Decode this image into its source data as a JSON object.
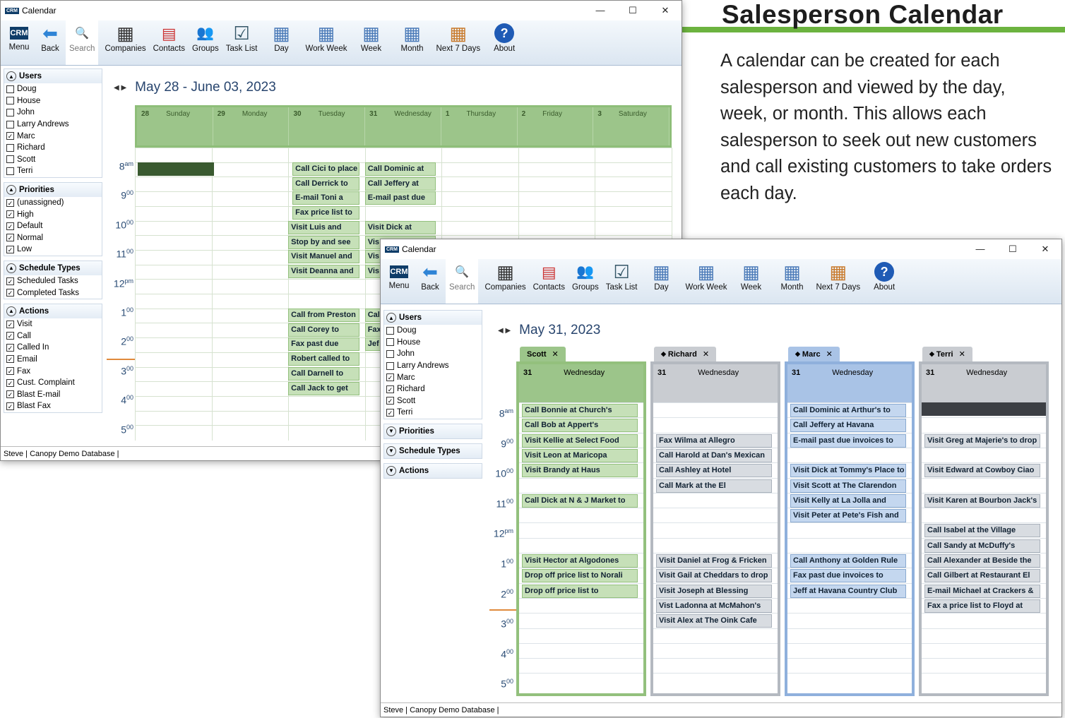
{
  "heading": "Salesperson Calendar",
  "paragraph": "A calendar can be created for each salesperson and viewed by the day, week, or month. This allows each salesperson to seek out new customers and call existing customers to take orders each day.",
  "colors": {
    "green": "#6cb33f",
    "scott": "#9cc58a",
    "richard": "#c9ccd1",
    "marc": "#a9c3e6",
    "terri": "#c9ccd1"
  },
  "window": {
    "title": "Calendar",
    "logo": "CRM",
    "min": "—",
    "max": "☐",
    "close": "✕"
  },
  "toolbar": [
    {
      "label": "Menu",
      "icon": "crm-logo-icon"
    },
    {
      "label": "Back",
      "icon": "back-arrow-icon"
    },
    {
      "label": "Search",
      "icon": "search-icon"
    },
    {
      "label": "Companies",
      "icon": "building-icon"
    },
    {
      "label": "Contacts",
      "icon": "contact-card-icon"
    },
    {
      "label": "Groups",
      "icon": "group-icon"
    },
    {
      "label": "Task List",
      "icon": "checklist-icon"
    },
    {
      "label": "Day",
      "icon": "calendar-day-icon"
    },
    {
      "label": "Work Week",
      "icon": "calendar-workweek-icon"
    },
    {
      "label": "Week",
      "icon": "calendar-week-icon"
    },
    {
      "label": "Month",
      "icon": "calendar-month-icon"
    },
    {
      "label": "Next 7 Days",
      "icon": "calendar-next7-icon"
    },
    {
      "label": "About",
      "icon": "help-icon"
    }
  ],
  "sidebar": {
    "users_title": "Users",
    "priorities_title": "Priorities",
    "schedule_types_title": "Schedule Types",
    "actions_title": "Actions",
    "users1": [
      {
        "n": "Doug",
        "c": false
      },
      {
        "n": "House",
        "c": false
      },
      {
        "n": "John",
        "c": false
      },
      {
        "n": "Larry Andrews",
        "c": false
      },
      {
        "n": "Marc",
        "c": true
      },
      {
        "n": "Richard",
        "c": false
      },
      {
        "n": "Scott",
        "c": false
      },
      {
        "n": "Terri",
        "c": false
      }
    ],
    "users2": [
      {
        "n": "Doug",
        "c": false
      },
      {
        "n": "House",
        "c": false
      },
      {
        "n": "John",
        "c": false
      },
      {
        "n": "Larry Andrews",
        "c": false
      },
      {
        "n": "Marc",
        "c": true
      },
      {
        "n": "Richard",
        "c": true
      },
      {
        "n": "Scott",
        "c": true
      },
      {
        "n": "Terri",
        "c": true
      }
    ],
    "priorities": [
      "(unassigned)",
      "High",
      "Default",
      "Normal",
      "Low"
    ],
    "schedule_types": [
      "Scheduled Tasks",
      "Completed Tasks"
    ],
    "actions": [
      "Visit",
      "Call",
      "Called In",
      "Email",
      "Fax",
      "Cust. Complaint",
      "Blast E-mail",
      "Blast Fax"
    ]
  },
  "status": "Steve | Canopy Demo Database |",
  "week": {
    "range": "May 28 - June 03, 2023",
    "days": [
      {
        "d": "28",
        "n": "Sunday"
      },
      {
        "d": "29",
        "n": "Monday"
      },
      {
        "d": "30",
        "n": "Tuesday"
      },
      {
        "d": "31",
        "n": "Wednesday"
      },
      {
        "d": "1",
        "n": "Thursday"
      },
      {
        "d": "2",
        "n": "Friday"
      },
      {
        "d": "3",
        "n": "Saturday"
      }
    ],
    "times": [
      [
        "8",
        "am"
      ],
      [
        "9",
        "00"
      ],
      [
        "10",
        "00"
      ],
      [
        "11",
        "00"
      ],
      [
        "12",
        "pm"
      ],
      [
        "1",
        "00"
      ],
      [
        "2",
        "00"
      ],
      [
        "3",
        "00"
      ],
      [
        "4",
        "00"
      ],
      [
        "5",
        "00"
      ]
    ],
    "events": [
      {
        "day": 2,
        "slot": 0,
        "t": "Call Cici to place"
      },
      {
        "day": 2,
        "slot": 1,
        "t": "Call Derrick to"
      },
      {
        "day": 2,
        "slot": 2,
        "t": "E-mail Toni a"
      },
      {
        "day": 2,
        "slot": 3,
        "t": "Fax price list to"
      },
      {
        "day": 2,
        "slot": 4,
        "t": "Visit Luis and"
      },
      {
        "day": 2,
        "slot": 5,
        "t": "Stop by and see"
      },
      {
        "day": 2,
        "slot": 6,
        "t": "Visit Manuel and"
      },
      {
        "day": 2,
        "slot": 7,
        "t": "Visit Deanna and"
      },
      {
        "day": 2,
        "slot": 10,
        "t": "Call from Preston"
      },
      {
        "day": 2,
        "slot": 11,
        "t": "Call Corey to"
      },
      {
        "day": 2,
        "slot": 12,
        "t": "Fax past due"
      },
      {
        "day": 2,
        "slot": 13,
        "t": "Robert called to"
      },
      {
        "day": 2,
        "slot": 14,
        "t": "Call Darnell to"
      },
      {
        "day": 2,
        "slot": 15,
        "t": "Call Jack to get"
      },
      {
        "day": 3,
        "slot": 0,
        "t": "Call Dominic at"
      },
      {
        "day": 3,
        "slot": 1,
        "t": "Call Jeffery at"
      },
      {
        "day": 3,
        "slot": 2,
        "t": "E-mail past due"
      },
      {
        "day": 3,
        "slot": 4,
        "t": "Visit Dick at"
      },
      {
        "day": 3,
        "slot": 5,
        "t": "Vis"
      },
      {
        "day": 3,
        "slot": 6,
        "t": "Vis"
      },
      {
        "day": 3,
        "slot": 7,
        "t": "Vis"
      },
      {
        "day": 3,
        "slot": 10,
        "t": "Cal"
      },
      {
        "day": 3,
        "slot": 11,
        "t": "Fax"
      },
      {
        "day": 3,
        "slot": 12,
        "t": "Jef"
      }
    ]
  },
  "day": {
    "date": "May 31, 2023",
    "day_num": "31",
    "day_name": "Wednesday",
    "times": [
      [
        "8",
        "am"
      ],
      [
        "9",
        "00"
      ],
      [
        "10",
        "00"
      ],
      [
        "11",
        "00"
      ],
      [
        "12",
        "pm"
      ],
      [
        "1",
        "00"
      ],
      [
        "2",
        "00"
      ],
      [
        "3",
        "00"
      ],
      [
        "4",
        "00"
      ],
      [
        "5",
        "00"
      ]
    ],
    "people": [
      {
        "name": "Scott",
        "close": "✕",
        "arrow": "",
        "events": [
          {
            "slot": 0,
            "t": "Call Bonnie at Church's"
          },
          {
            "slot": 1,
            "t": "Call Bob at Appert's"
          },
          {
            "slot": 2,
            "t": "Visit Kellie at Select Food"
          },
          {
            "slot": 3,
            "t": "Visit Leon at Maricopa"
          },
          {
            "slot": 4,
            "t": "Visit Brandy at Haus"
          },
          {
            "slot": 6,
            "t": "Call Dick at N & J Market to"
          },
          {
            "slot": 10,
            "t": "Visit Hector at Algodones"
          },
          {
            "slot": 11,
            "t": "Drop off price list to Norali"
          },
          {
            "slot": 12,
            "t": "Drop off price list to"
          }
        ]
      },
      {
        "name": "Richard",
        "close": "✕",
        "arrow": "◆",
        "events": [
          {
            "slot": 2,
            "t": "Fax Wilma at Allegro"
          },
          {
            "slot": 3,
            "t": "Call Harold at Dan's Mexican"
          },
          {
            "slot": 4,
            "t": "Call Ashley at Hotel"
          },
          {
            "slot": 5,
            "t": "Call Mark at the El"
          },
          {
            "slot": 10,
            "t": "Visit Daniel at Frog & Fricken"
          },
          {
            "slot": 11,
            "t": "Visit Gail at Cheddars to drop"
          },
          {
            "slot": 12,
            "t": "Visit Joseph at Blessing"
          },
          {
            "slot": 13,
            "t": "Vist Ladonna at McMahon's"
          },
          {
            "slot": 14,
            "t": "Visit Alex at The Oink Cafe"
          }
        ]
      },
      {
        "name": "Marc",
        "close": "✕",
        "arrow": "◆",
        "events": [
          {
            "slot": 0,
            "t": "Call Dominic at Arthur's to"
          },
          {
            "slot": 1,
            "t": "Call Jeffery at Havana"
          },
          {
            "slot": 2,
            "t": "E-mail past due invoices to"
          },
          {
            "slot": 4,
            "t": "Visit Dick at Tommy's Place to"
          },
          {
            "slot": 5,
            "t": "Visit Scott at The Clarendon"
          },
          {
            "slot": 6,
            "t": "Visit Kelly at La Jolla and"
          },
          {
            "slot": 7,
            "t": "Visit Peter at Pete's Fish and"
          },
          {
            "slot": 10,
            "t": "Call Anthony at Golden Rule"
          },
          {
            "slot": 11,
            "t": "Fax past due invoices to"
          },
          {
            "slot": 12,
            "t": "Jeff at Havana Country Club"
          }
        ]
      },
      {
        "name": "Terri",
        "close": "✕",
        "arrow": "◆",
        "events": [
          {
            "slot": 2,
            "t": "Visit Greg at Majerie's to drop"
          },
          {
            "slot": 4,
            "t": "Visit Edward at Cowboy Ciao"
          },
          {
            "slot": 6,
            "t": "Visit Karen at Bourbon Jack's"
          },
          {
            "slot": 8,
            "t": "Call Isabel at the Village"
          },
          {
            "slot": 9,
            "t": "Call Sandy at McDuffy's"
          },
          {
            "slot": 10,
            "t": "Call Alexander at Beside the"
          },
          {
            "slot": 11,
            "t": "Call Gilbert at Restaurant El"
          },
          {
            "slot": 12,
            "t": "E-mail Michael at Crackers &"
          },
          {
            "slot": 13,
            "t": "Fax a price list to Floyd at"
          }
        ]
      }
    ]
  }
}
